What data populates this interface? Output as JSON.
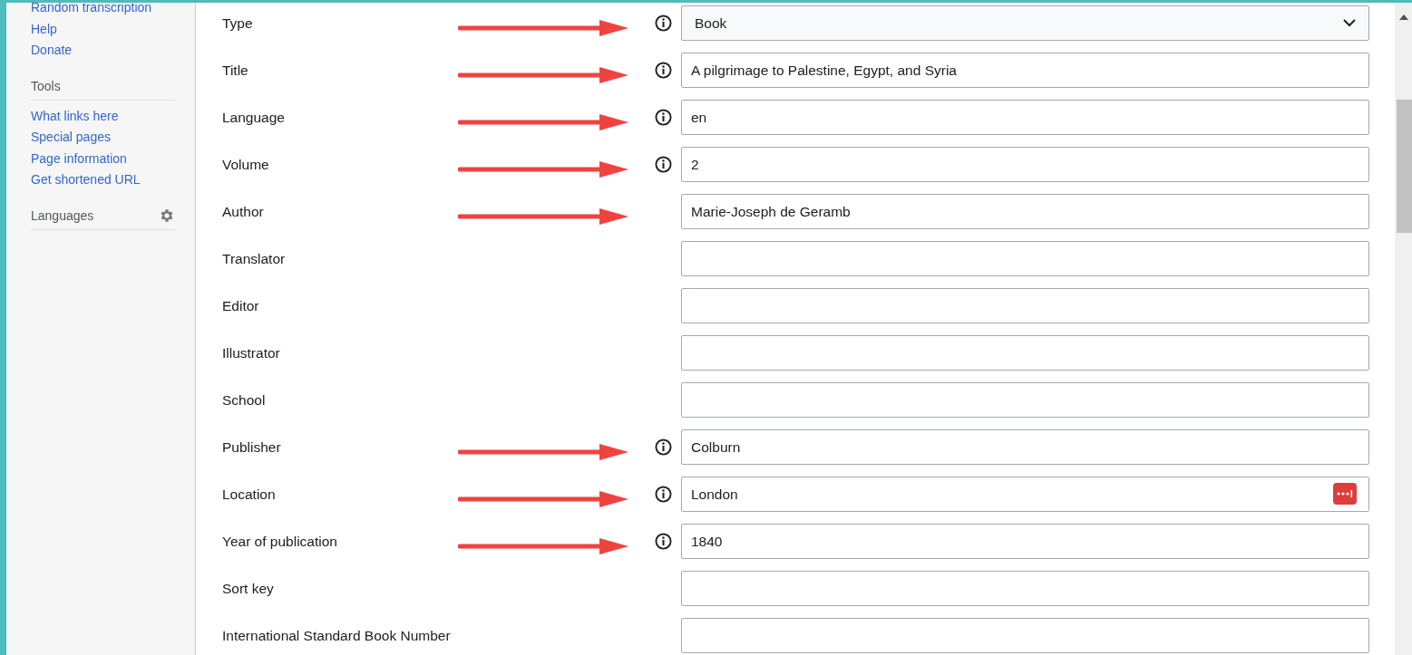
{
  "sidebar": {
    "links": [
      "Random transcription",
      "Help",
      "Donate"
    ],
    "sections": [
      {
        "heading": "Tools",
        "settings": false,
        "links": [
          "What links here",
          "Special pages",
          "Page information",
          "Get shortened URL"
        ]
      },
      {
        "heading": "Languages",
        "settings": true
      }
    ]
  },
  "form": {
    "rows": [
      {
        "label": "Type",
        "kind": "select",
        "value": "Book",
        "info": true,
        "arrow": true,
        "autofill_icon": false
      },
      {
        "label": "Title",
        "kind": "text",
        "value": "A pilgrimage to Palestine, Egypt, and Syria",
        "info": true,
        "arrow": true,
        "autofill_icon": false
      },
      {
        "label": "Language",
        "kind": "text",
        "value": "en",
        "info": true,
        "arrow": true,
        "autofill_icon": false
      },
      {
        "label": "Volume",
        "kind": "text",
        "value": "2",
        "info": true,
        "arrow": true,
        "autofill_icon": false
      },
      {
        "label": "Author",
        "kind": "text",
        "value": "Marie-Joseph de Geramb",
        "info": false,
        "arrow": true,
        "autofill_icon": false
      },
      {
        "label": "Translator",
        "kind": "text",
        "info": false,
        "arrow": false,
        "autofill_icon": false
      },
      {
        "label": "Editor",
        "kind": "text",
        "info": false,
        "arrow": false,
        "autofill_icon": false
      },
      {
        "label": "Illustrator",
        "kind": "text",
        "info": false,
        "arrow": false,
        "autofill_icon": false
      },
      {
        "label": "School",
        "kind": "text",
        "info": false,
        "arrow": false,
        "autofill_icon": false
      },
      {
        "label": "Publisher",
        "kind": "text",
        "value": "Colburn",
        "info": true,
        "arrow": true,
        "autofill_icon": false
      },
      {
        "label": "Location",
        "kind": "text",
        "value": "London",
        "info": true,
        "arrow": true,
        "autofill_icon": true
      },
      {
        "label": "Year of publication",
        "kind": "text",
        "value": "1840",
        "info": true,
        "arrow": true,
        "autofill_icon": false
      },
      {
        "label": "Sort key",
        "kind": "text",
        "info": false,
        "arrow": false,
        "autofill_icon": false
      },
      {
        "label": "International Standard Book Number",
        "kind": "text",
        "info": false,
        "arrow": false,
        "autofill_icon": false
      }
    ]
  }
}
